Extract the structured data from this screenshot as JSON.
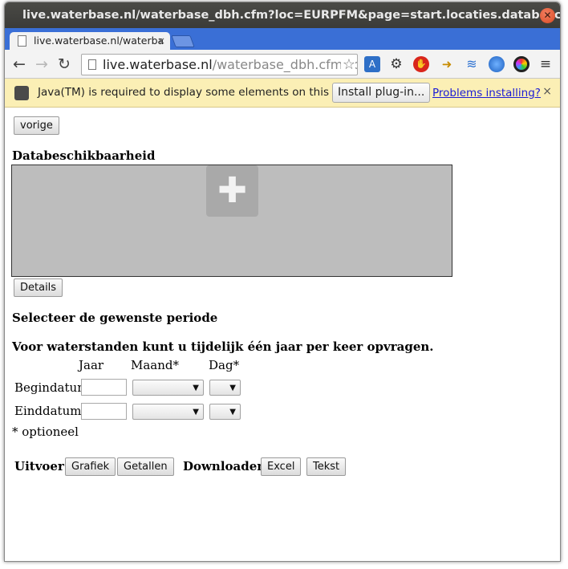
{
  "window": {
    "title": "live.waterbase.nl/waterbase_dbh.cfm?loc=EURPFM&page=start.locaties.databeschikbaarheid"
  },
  "tab": {
    "label": "live.waterbase.nl/waterba",
    "close_glyph": "×"
  },
  "address": {
    "domain": "live.waterbase.nl",
    "path": "/waterbase_dbh.cfm?loc="
  },
  "infobar": {
    "message": "Java(TM) is required to display some elements on this pa...",
    "install_label": "Install plug-in...",
    "problems_label": "Problems installing?",
    "close_glyph": "×"
  },
  "page": {
    "back_label": "vorige",
    "section_title": "Databeschikbaarheid",
    "details_label": "Details",
    "period_heading": "Selecteer de gewenste periode",
    "note_heading": "Voor waterstanden kunt u tijdelijk één jaar per keer opvragen.",
    "columns": {
      "year": "Jaar",
      "month": "Maand*",
      "day": "Dag*"
    },
    "rows": [
      {
        "label": "Begindatum",
        "year": "",
        "month": "",
        "day": ""
      },
      {
        "label": "Einddatum*",
        "year": "",
        "month": "",
        "day": ""
      }
    ],
    "optional_note": "* optioneel",
    "output_label": "Uitvoer:",
    "chart_button": "Grafiek",
    "numbers_button": "Getallen",
    "downloads_label": "Downloaden:",
    "excel_button": "Excel",
    "text_button": "Tekst"
  },
  "colors": {
    "tabstrip": "#3a6fd6",
    "infobar": "#fbefb5",
    "applet_bg": "#bdbdbd",
    "link": "#1b1bd6"
  }
}
